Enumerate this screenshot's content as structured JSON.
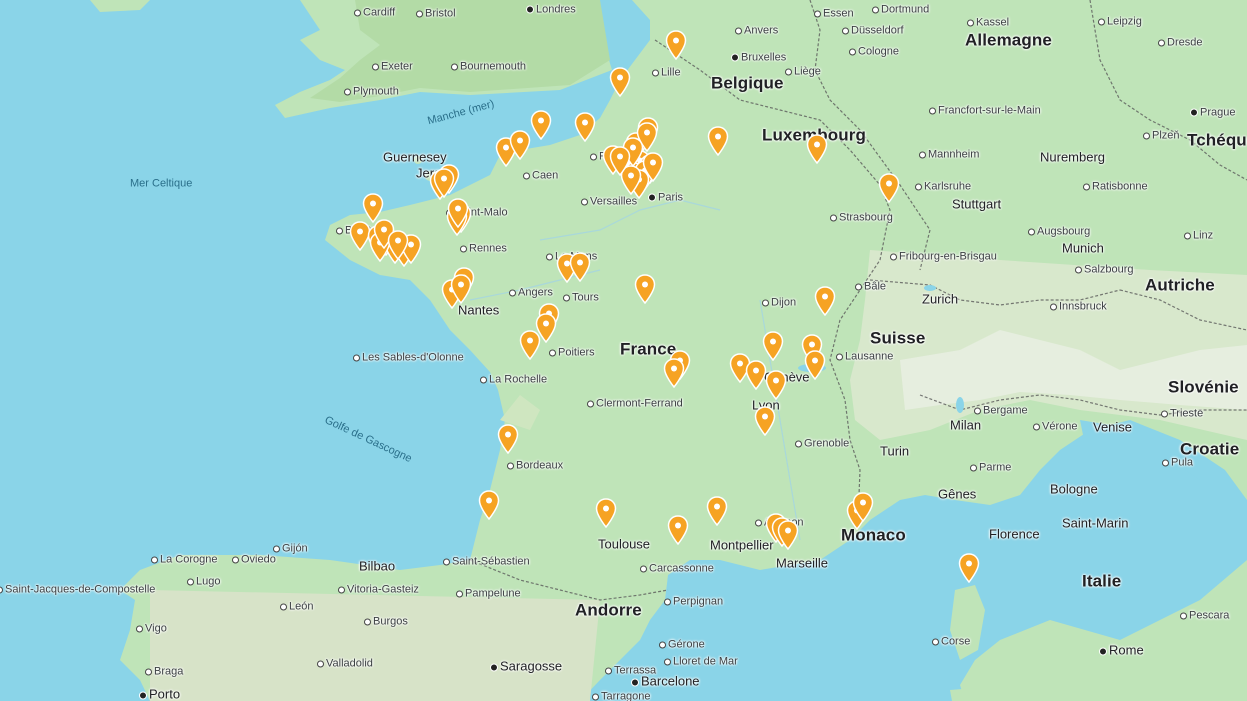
{
  "map": {
    "sea_labels": [
      {
        "id": "manche",
        "text": "Manche (mer)"
      },
      {
        "id": "celtique",
        "text": "Mer Celtique"
      },
      {
        "id": "gascogne",
        "text": "Golfe de Gascogne"
      }
    ],
    "countries": [
      {
        "id": "belgique",
        "text": "Belgique"
      },
      {
        "id": "allemagne",
        "text": "Allemagne"
      },
      {
        "id": "luxembourg",
        "text": "Luxembourg"
      },
      {
        "id": "tcheque",
        "text": "Tchéque"
      },
      {
        "id": "france",
        "text": "France"
      },
      {
        "id": "suisse",
        "text": "Suisse"
      },
      {
        "id": "autriche",
        "text": "Autriche"
      },
      {
        "id": "slovenie",
        "text": "Slovénie"
      },
      {
        "id": "croatie",
        "text": "Croatie"
      },
      {
        "id": "italie",
        "text": "Italie"
      },
      {
        "id": "andorre",
        "text": "Andorre"
      },
      {
        "id": "monaco",
        "text": "Monaco"
      },
      {
        "id": "saint-marin",
        "text": "Saint-Marin"
      },
      {
        "id": "guernesey",
        "text": "Guernesey"
      },
      {
        "id": "jersey",
        "text": "Jersey"
      }
    ],
    "cities": [
      {
        "id": "cardiff",
        "text": "Cardiff"
      },
      {
        "id": "bristol",
        "text": "Bristol"
      },
      {
        "id": "londres",
        "text": "Londres"
      },
      {
        "id": "exeter",
        "text": "Exeter"
      },
      {
        "id": "bournemouth",
        "text": "Bournemouth"
      },
      {
        "id": "plymouth",
        "text": "Plymouth"
      },
      {
        "id": "essen",
        "text": "Essen"
      },
      {
        "id": "dortmund",
        "text": "Dortmund"
      },
      {
        "id": "kassel",
        "text": "Kassel"
      },
      {
        "id": "leipzig",
        "text": "Leipzig"
      },
      {
        "id": "dresde",
        "text": "Dresde"
      },
      {
        "id": "anvers",
        "text": "Anvers"
      },
      {
        "id": "dusseldorf",
        "text": "Düsseldorf"
      },
      {
        "id": "bruxelles",
        "text": "Bruxelles"
      },
      {
        "id": "cologne",
        "text": "Cologne"
      },
      {
        "id": "lille",
        "text": "Lille"
      },
      {
        "id": "liege",
        "text": "Liège"
      },
      {
        "id": "francfort",
        "text": "Francfort-sur-le-Main"
      },
      {
        "id": "prague",
        "text": "Prague"
      },
      {
        "id": "plzen",
        "text": "Plzeň"
      },
      {
        "id": "rouen",
        "text": "Rouen"
      },
      {
        "id": "caen",
        "text": "Caen"
      },
      {
        "id": "mannheim",
        "text": "Mannheim"
      },
      {
        "id": "nuremberg",
        "text": "Nuremberg"
      },
      {
        "id": "paris",
        "text": "Paris"
      },
      {
        "id": "versailles",
        "text": "Versailles"
      },
      {
        "id": "karlsruhe",
        "text": "Karlsruhe"
      },
      {
        "id": "ratisbonne",
        "text": "Ratisbonne"
      },
      {
        "id": "saint-malo",
        "text": "Saint-Malo"
      },
      {
        "id": "stuttgart",
        "text": "Stuttgart"
      },
      {
        "id": "strasbourg",
        "text": "Strasbourg"
      },
      {
        "id": "brest",
        "text": "Brest"
      },
      {
        "id": "rennes",
        "text": "Rennes"
      },
      {
        "id": "augsbourg",
        "text": "Augsbourg"
      },
      {
        "id": "linz",
        "text": "Linz"
      },
      {
        "id": "munich",
        "text": "Munich"
      },
      {
        "id": "le-mans",
        "text": "Le Mans"
      },
      {
        "id": "fribourg",
        "text": "Fribourg-en-Brisgau"
      },
      {
        "id": "salzbourg",
        "text": "Salzbourg"
      },
      {
        "id": "bale",
        "text": "Bâle"
      },
      {
        "id": "angers",
        "text": "Angers"
      },
      {
        "id": "tours",
        "text": "Tours"
      },
      {
        "id": "zurich",
        "text": "Zurich"
      },
      {
        "id": "dijon",
        "text": "Dijon"
      },
      {
        "id": "innsbruck",
        "text": "Innsbruck"
      },
      {
        "id": "nantes",
        "text": "Nantes"
      },
      {
        "id": "poitiers",
        "text": "Poitiers"
      },
      {
        "id": "lausanne",
        "text": "Lausanne"
      },
      {
        "id": "sables",
        "text": "Les Sables-d'Olonne"
      },
      {
        "id": "geneve",
        "text": "Genève"
      },
      {
        "id": "la-rochelle",
        "text": "La Rochelle"
      },
      {
        "id": "clermont",
        "text": "Clermont-Ferrand"
      },
      {
        "id": "lyon",
        "text": "Lyon"
      },
      {
        "id": "bergame",
        "text": "Bergame"
      },
      {
        "id": "milan",
        "text": "Milan"
      },
      {
        "id": "verone",
        "text": "Vérone"
      },
      {
        "id": "venise",
        "text": "Venise"
      },
      {
        "id": "trieste",
        "text": "Trieste"
      },
      {
        "id": "grenoble",
        "text": "Grenoble"
      },
      {
        "id": "turin",
        "text": "Turin"
      },
      {
        "id": "bordeaux",
        "text": "Bordeaux"
      },
      {
        "id": "pula",
        "text": "Pula"
      },
      {
        "id": "parme",
        "text": "Parme"
      },
      {
        "id": "bologne",
        "text": "Bologne"
      },
      {
        "id": "genes",
        "text": "Gênes"
      },
      {
        "id": "avignon",
        "text": "Avignon"
      },
      {
        "id": "florence",
        "text": "Florence"
      },
      {
        "id": "toulouse",
        "text": "Toulouse"
      },
      {
        "id": "montpellier",
        "text": "Montpellier"
      },
      {
        "id": "marseille",
        "text": "Marseille"
      },
      {
        "id": "gijon",
        "text": "Gijón"
      },
      {
        "id": "la-corogne",
        "text": "La Corogne"
      },
      {
        "id": "oviedo",
        "text": "Oviedo"
      },
      {
        "id": "bilbao",
        "text": "Bilbao"
      },
      {
        "id": "saint-sebastien",
        "text": "Saint-Sébastien"
      },
      {
        "id": "carcassonne",
        "text": "Carcassonne"
      },
      {
        "id": "saint-jacques",
        "text": "Saint-Jacques-de-Compostelle"
      },
      {
        "id": "lugo",
        "text": "Lugo"
      },
      {
        "id": "vitoria",
        "text": "Vitoria-Gasteiz"
      },
      {
        "id": "pampelune",
        "text": "Pampelune"
      },
      {
        "id": "perpignan",
        "text": "Perpignan"
      },
      {
        "id": "leon",
        "text": "León"
      },
      {
        "id": "burgos",
        "text": "Burgos"
      },
      {
        "id": "vigo",
        "text": "Vigo"
      },
      {
        "id": "corse",
        "text": "Corse"
      },
      {
        "id": "pescara",
        "text": "Pescara"
      },
      {
        "id": "gerone",
        "text": "Gérone"
      },
      {
        "id": "braga",
        "text": "Braga"
      },
      {
        "id": "valladolid",
        "text": "Valladolid"
      },
      {
        "id": "saragosse",
        "text": "Saragosse"
      },
      {
        "id": "lloret",
        "text": "Lloret de Mar"
      },
      {
        "id": "rome",
        "text": "Rome"
      },
      {
        "id": "terrassa",
        "text": "Terrassa"
      },
      {
        "id": "barcelone",
        "text": "Barcelone"
      },
      {
        "id": "porto",
        "text": "Porto"
      },
      {
        "id": "tarragone",
        "text": "Tarragone"
      }
    ],
    "marker_icon": "map-pin-icon",
    "marker_color": "#f6a323",
    "marker_count": 69
  }
}
